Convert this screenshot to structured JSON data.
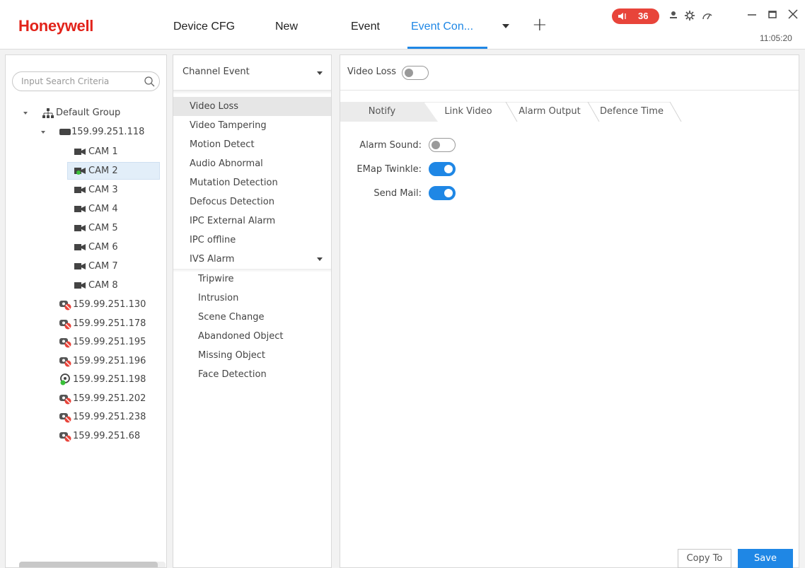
{
  "header": {
    "logo": "Honeywell",
    "tabs": [
      {
        "label": "Device CFG"
      },
      {
        "label": "New"
      },
      {
        "label": "Event"
      },
      {
        "label": "Event Con..."
      }
    ],
    "alarm_count": "36",
    "time": "11:05:20",
    "accent_color": "#1f87e5",
    "alarm_color": "#e8443a"
  },
  "left": {
    "search_placeholder": "Input Search Criteria",
    "root": "Default Group",
    "device": "159.99.251.118",
    "cams": [
      "CAM 1",
      "CAM 2",
      "CAM 3",
      "CAM 4",
      "CAM 5",
      "CAM 6",
      "CAM 7",
      "CAM 8"
    ],
    "selected_cam": "CAM 2",
    "devices": [
      "159.99.251.130",
      "159.99.251.178",
      "159.99.251.195",
      "159.99.251.196",
      "159.99.251.198",
      "159.99.251.202",
      "159.99.251.238",
      "159.99.251.68"
    ]
  },
  "middle": {
    "select_label": "Channel Event",
    "events": [
      "Video Loss",
      "Video Tampering",
      "Motion Detect",
      "Audio Abnormal",
      "Mutation Detection",
      "Defocus Detection",
      "IPC External Alarm",
      "IPC offline"
    ],
    "selected_event": "Video Loss",
    "ivs_label": "IVS Alarm",
    "ivs_items": [
      "Tripwire",
      "Intrusion",
      "Scene Change",
      "Abandoned Object",
      "Missing Object",
      "Face Detection"
    ]
  },
  "right": {
    "head_label": "Video Loss",
    "head_toggle": false,
    "subtabs": [
      "Notify",
      "Link Video",
      "Alarm Output",
      "Defence Time"
    ],
    "active_subtab": "Notify",
    "fields": [
      {
        "label": "Alarm Sound:",
        "value": false
      },
      {
        "label": "EMap Twinkle:",
        "value": true
      },
      {
        "label": "Send Mail:",
        "value": true
      }
    ],
    "copy_label": "Copy To",
    "save_label": "Save"
  }
}
